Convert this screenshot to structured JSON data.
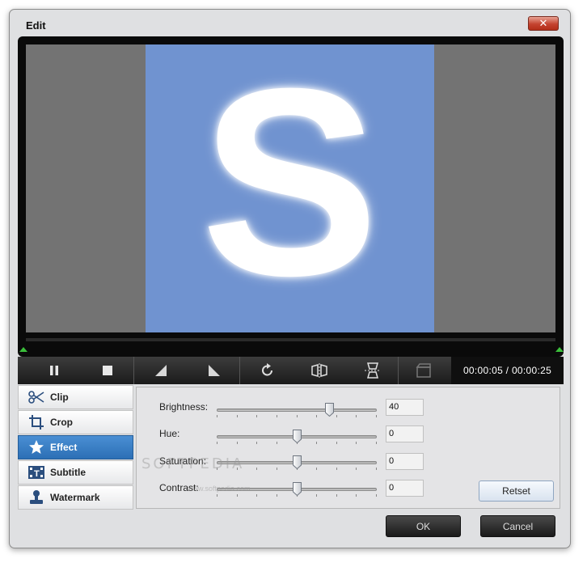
{
  "window": {
    "title": "Edit",
    "close_glyph": "✕"
  },
  "preview": {
    "letter": "S",
    "background_color": "#737373",
    "content_color": "#7093d0"
  },
  "controls": {
    "time": "00:00:05 / 00:00:25",
    "buttons": [
      "pause-icon",
      "stop-icon",
      "flip-left-icon",
      "flip-right-icon",
      "rotate-icon",
      "mirror-horizontal-icon",
      "mirror-vertical-icon",
      "snapshot-icon"
    ]
  },
  "tabs": [
    {
      "label": "Clip",
      "icon": "scissors-icon"
    },
    {
      "label": "Crop",
      "icon": "crop-icon"
    },
    {
      "label": "Effect",
      "icon": "star-icon",
      "active": true
    },
    {
      "label": "Subtitle",
      "icon": "subtitle-icon"
    },
    {
      "label": "Watermark",
      "icon": "stamp-icon"
    }
  ],
  "effects": {
    "brightness": {
      "label": "Brightness:",
      "value": "40",
      "fraction": 0.7
    },
    "hue": {
      "label": "Hue:",
      "value": "0",
      "fraction": 0.5
    },
    "saturation": {
      "label": "Saturation:",
      "value": "0",
      "fraction": 0.5
    },
    "contrast": {
      "label": "Contrast:",
      "value": "0",
      "fraction": 0.5
    },
    "reset_label": "Retset"
  },
  "footer": {
    "ok_label": "OK",
    "cancel_label": "Cancel"
  },
  "watermark": {
    "text": "SOFTPEDIA",
    "url": "www.softpedia.com"
  }
}
